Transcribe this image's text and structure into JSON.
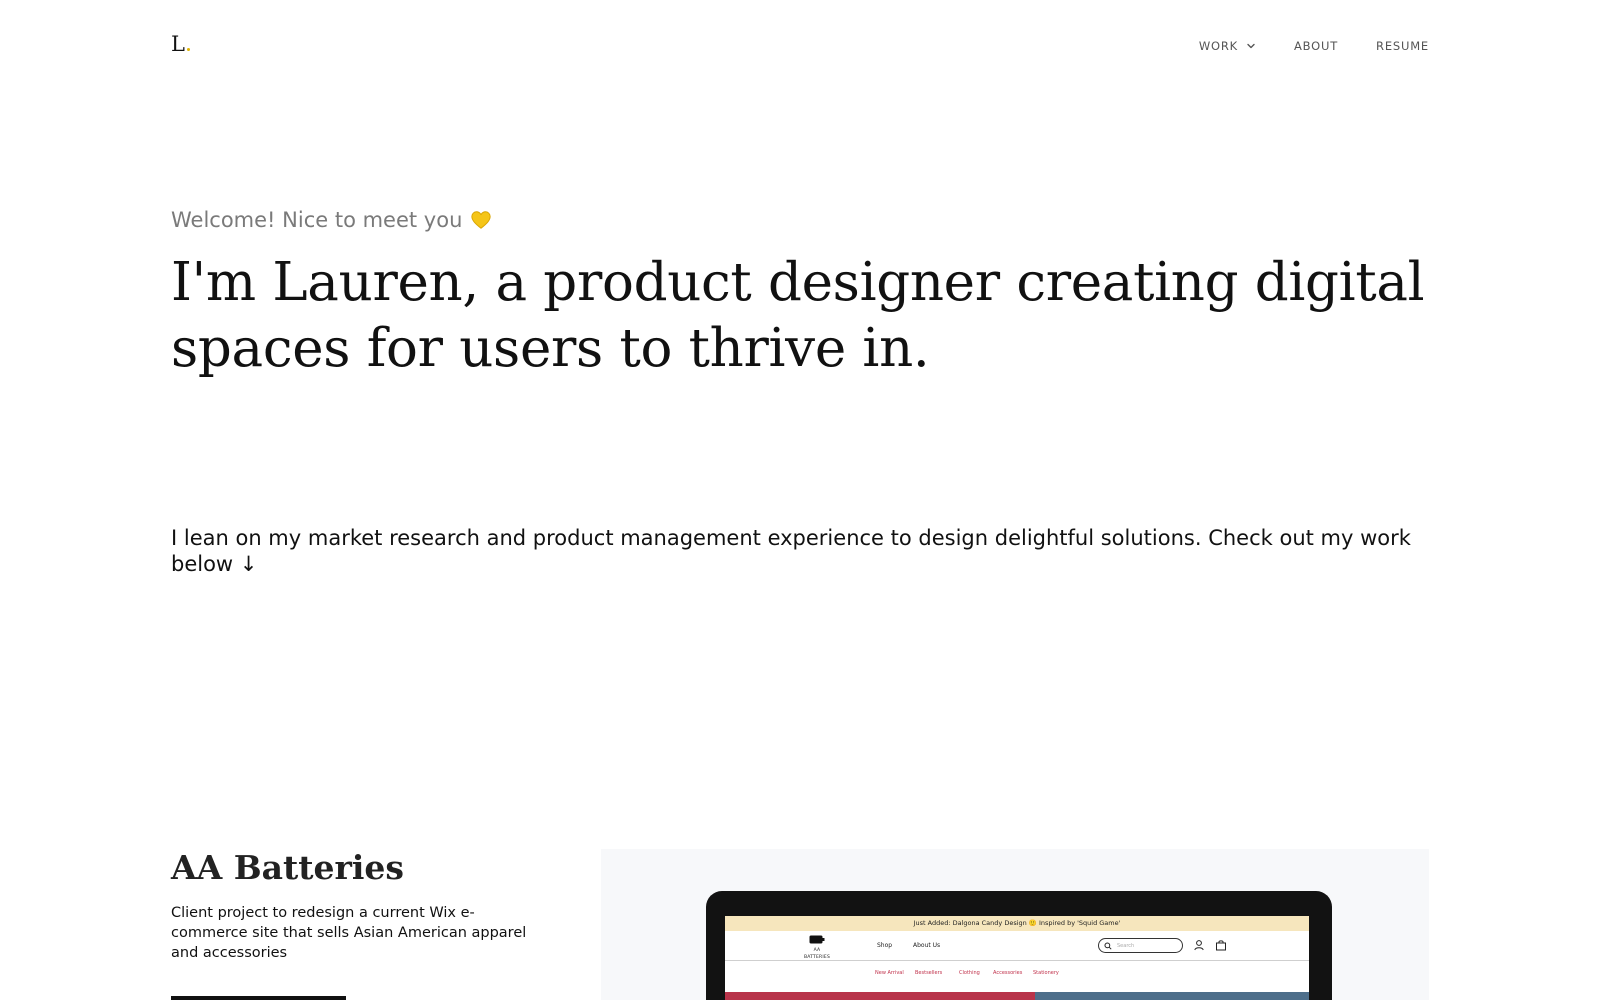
{
  "header": {
    "logo": "L",
    "nav": [
      {
        "label": "WORK",
        "has_dropdown": true
      },
      {
        "label": "ABOUT",
        "has_dropdown": false
      },
      {
        "label": "RESUME",
        "has_dropdown": false
      }
    ]
  },
  "hero": {
    "welcome": "Welcome! Nice to meet you",
    "welcome_icon": "yellow-heart-icon",
    "headline": "I'm Lauren, a product designer creating digital spaces for users to thrive in.",
    "intro": "I lean on my market research and product management experience to design delightful solutions. Check out my work below ↓"
  },
  "project": {
    "title": "AA Batteries",
    "description": "Client project to redesign a current Wix e-commerce site that sells Asian American apparel and accessories",
    "preview": {
      "announcement": "Just Added: Dalgona Candy Design 🙂 Inspired by 'Squid Game'",
      "logo_text": "AA BATTERIES",
      "nav": [
        "Shop",
        "About Us"
      ],
      "search_placeholder": "Search",
      "categories": [
        "New Arrival",
        "Bestsellers",
        "Clothing",
        "Accessories",
        "Stationery"
      ]
    }
  },
  "colors": {
    "accent_yellow": "#e0b400",
    "heading": "#111111",
    "muted": "#7a7a7a",
    "preview_bg": "#f7f8fa",
    "announce_bg": "#f6e6bd",
    "category_red": "#c0304a"
  }
}
